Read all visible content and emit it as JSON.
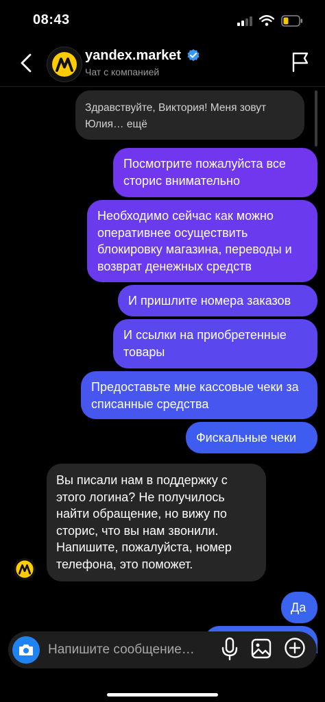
{
  "status_bar": {
    "time": "08:43",
    "battery_color": "#f7c600"
  },
  "header": {
    "title": "yandex.market",
    "subtitle": "Чат с компанией",
    "verified_color": "#3897f0",
    "avatar_color": "#ffcc00"
  },
  "messages": {
    "first_incoming": "Здравствуйте, Виктория! Меня зовут Юлия… ещё",
    "out1": "Посмотрите пожалуйста все сторис внимательно",
    "out2": "Необходимо сейчас как можно оперативнее осуществить блокировку магазина, переводы и возврат денежных средств",
    "out3": "И пришлите номера заказов",
    "out4": "И ссылки на приобретенные товары",
    "out5": "Предоставьте мне кассовые чеки за списанные средства",
    "out6": "Фискальные чеки",
    "incoming2": "Вы писали нам в поддержку с этого логина? Не получилось найти обращение, но вижу по сторис, что вы нам звонили. Напишите, пожалуйста, номер телефона, это поможет.",
    "out7": "Да"
  },
  "composer": {
    "placeholder": "Напишите сообщение…"
  },
  "colors": {
    "bubble_purple": "#7037ee",
    "bubble_indigo": "#5a48ee",
    "bubble_blue": "#3a63f0",
    "camera_blue": "#1f84f1"
  }
}
